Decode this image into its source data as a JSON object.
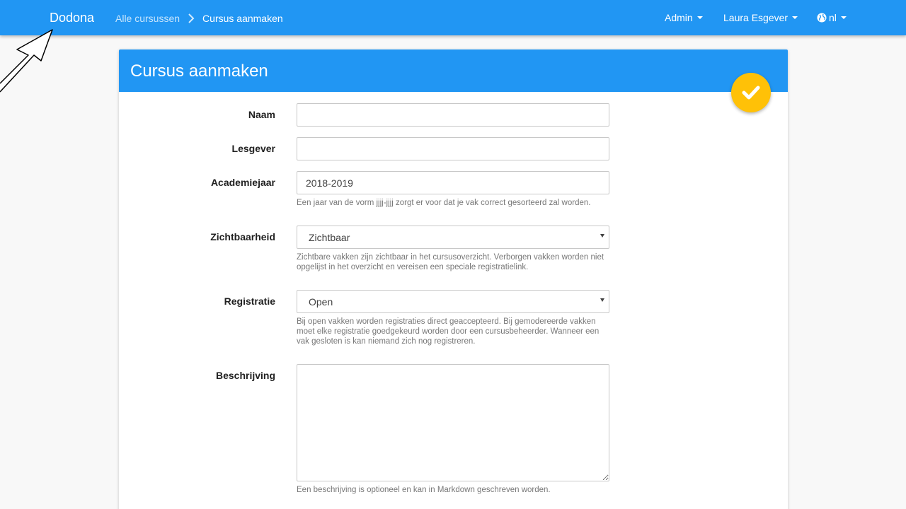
{
  "navbar": {
    "brand": "Dodona",
    "breadcrumb_link": "Alle cursussen",
    "breadcrumb_current": "Cursus aanmaken",
    "admin": "Admin",
    "user": "Laura Esgever",
    "language": "nl"
  },
  "card": {
    "title": "Cursus aanmaken"
  },
  "form": {
    "name": {
      "label": "Naam",
      "value": ""
    },
    "teacher": {
      "label": "Lesgever",
      "value": ""
    },
    "year": {
      "label": "Academiejaar",
      "value": "2018-2019",
      "help": "Een jaar van de vorm jjjj-jjjj zorgt er voor dat je vak correct gesorteerd zal worden."
    },
    "visibility": {
      "label": "Zichtbaarheid",
      "value": "Zichtbaar",
      "help": "Zichtbare vakken zijn zichtbaar in het cursusoverzicht. Verborgen vakken worden niet opgelijst in het overzicht en vereisen een speciale registratielink."
    },
    "registration": {
      "label": "Registratie",
      "value": "Open",
      "help": "Bij open vakken worden registraties direct geaccepteerd. Bij gemodereerde vakken moet elke registratie goedgekeurd worden door een cursusbeheerder. Wanneer een vak gesloten is kan niemand zich nog registreren."
    },
    "description": {
      "label": "Beschrijving",
      "value": "",
      "help": "Een beschrijving is optioneel en kan in Markdown geschreven worden."
    }
  },
  "colors": {
    "primary": "#2196f3",
    "accent": "#ffc107"
  },
  "icons": [
    "chevron-right-icon",
    "caret-down-icon",
    "globe-icon",
    "check-icon",
    "arrow-cursor-icon"
  ]
}
